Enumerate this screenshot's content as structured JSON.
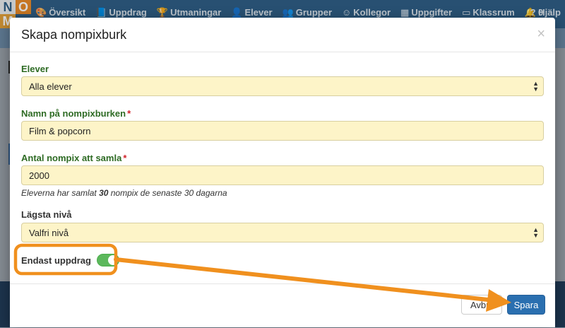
{
  "logo": {
    "letters": [
      "N",
      "O",
      "M",
      ""
    ],
    "colors": [
      "#e8ebee",
      "#e98b2a",
      "#e3a13a",
      "#2f5f86"
    ]
  },
  "nav": {
    "items": [
      {
        "icon": "palette-icon",
        "glyph": "🎨",
        "label": "Översikt"
      },
      {
        "icon": "book-icon",
        "glyph": "📘",
        "label": "Uppdrag"
      },
      {
        "icon": "trophy-icon",
        "glyph": "🏆",
        "label": "Utmaningar"
      },
      {
        "icon": "user-icon",
        "glyph": "👤",
        "label": "Elever"
      },
      {
        "icon": "users-icon",
        "glyph": "👥",
        "label": "Grupper"
      },
      {
        "icon": "smiley-icon",
        "glyph": "☺",
        "label": "Kollegor"
      },
      {
        "icon": "grid-icon",
        "glyph": "▦",
        "label": "Uppgifter"
      },
      {
        "icon": "monitor-icon",
        "glyph": "▭",
        "label": "Klassrum"
      },
      {
        "icon": "bell-icon",
        "glyph": "🔔",
        "label": "0"
      }
    ],
    "help": {
      "icon": "question-icon",
      "glyph": "?",
      "label": "Hjälp"
    }
  },
  "modal": {
    "title": "Skapa nompixburk",
    "close_glyph": "×",
    "fields": {
      "students": {
        "label": "Elever",
        "value": "Alla elever"
      },
      "name": {
        "label": "Namn på nompixburken",
        "required_mark": "*",
        "value": "Film & popcorn"
      },
      "amount": {
        "label": "Antal nompix att samla",
        "required_mark": "*",
        "value": "2000",
        "help_prefix": "Eleverna har samlat ",
        "help_value": "30",
        "help_suffix": " nompix de senaste 30 dagarna"
      },
      "level": {
        "label": "Lägsta nivå",
        "value": "Valfri nivå"
      },
      "only_assignments": {
        "label": "Endast uppdrag",
        "on": true
      }
    },
    "footer": {
      "cancel_label": "Avbryt",
      "save_label": "Spara"
    }
  },
  "annotation": {
    "color": "#f0901e"
  }
}
